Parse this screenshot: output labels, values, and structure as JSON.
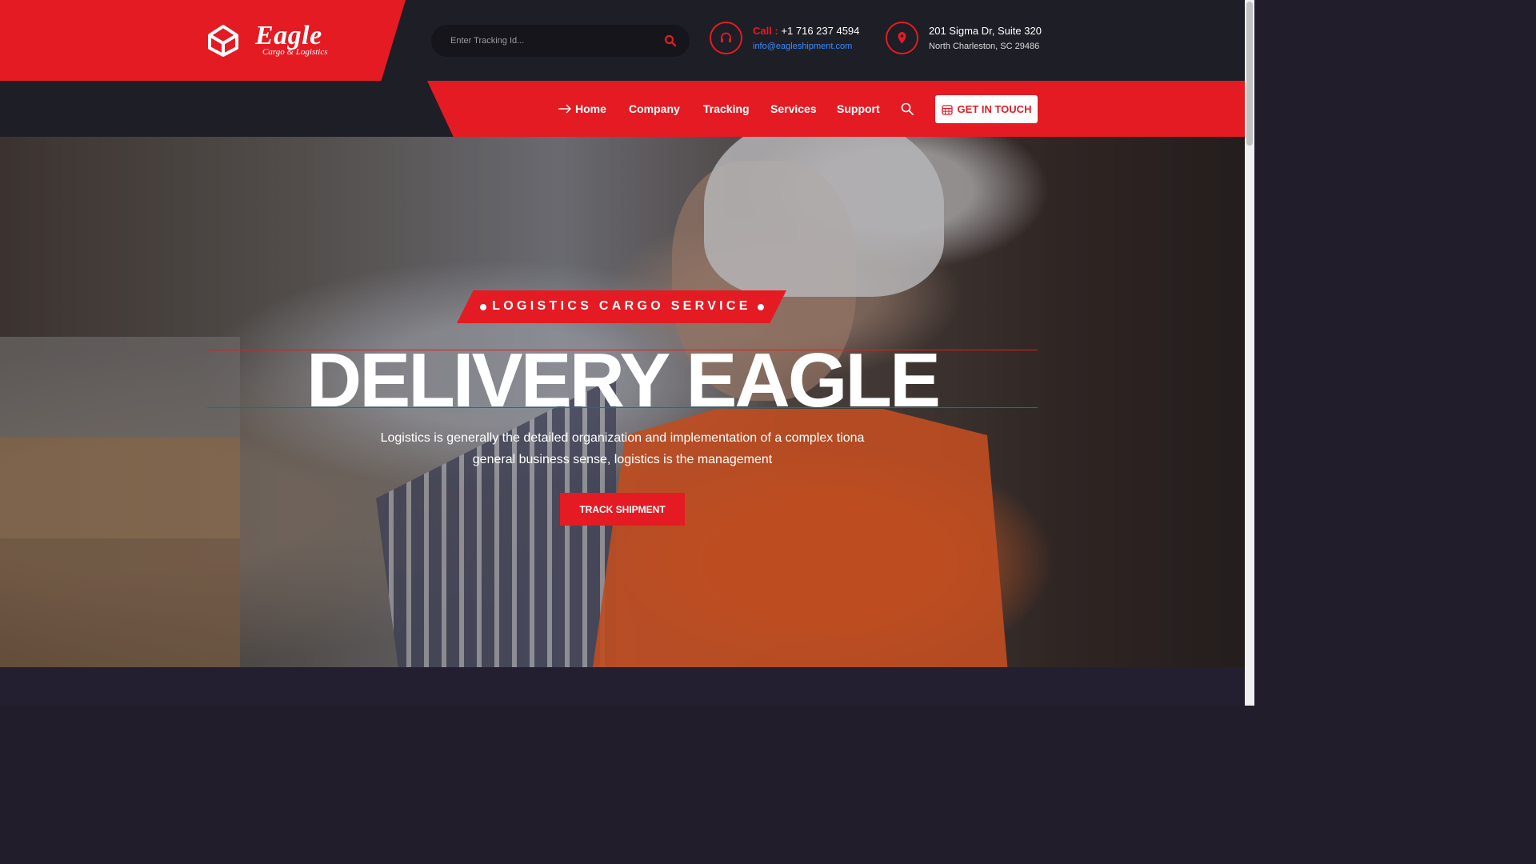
{
  "brand": {
    "name": "Eagle",
    "tagline": "Cargo & Logistics"
  },
  "search": {
    "placeholder": "Enter Tracking Id..."
  },
  "contact": {
    "call_label": "Call :",
    "phone": "+1 716 237 4594",
    "email": "info@eagleshipment.com",
    "address_line1": "201 Sigma Dr, Suite 320",
    "address_line2": "North Charleston, SC 29486"
  },
  "nav": {
    "items": [
      {
        "label": "Home"
      },
      {
        "label": "Company"
      },
      {
        "label": "Tracking"
      },
      {
        "label": "Services"
      },
      {
        "label": "Support"
      }
    ],
    "cta_label": "GET IN TOUCH"
  },
  "hero": {
    "badge": "LOGISTICS CARGO SERVICE",
    "title": "DELIVERY EAGLE",
    "description_line1": "Logistics is generally the detailed organization and implementation of a complex tiona",
    "description_line2": "general business sense, logistics is the management",
    "button_label": "TRACK SHIPMENT"
  },
  "colors": {
    "accent": "#e41b23",
    "dark": "#1e1e26",
    "email": "#3b8cff"
  },
  "icons": [
    "cube-logo-icon",
    "search-icon",
    "headset-icon",
    "map-pin-icon",
    "arrow-right-icon",
    "calendar-icon"
  ]
}
